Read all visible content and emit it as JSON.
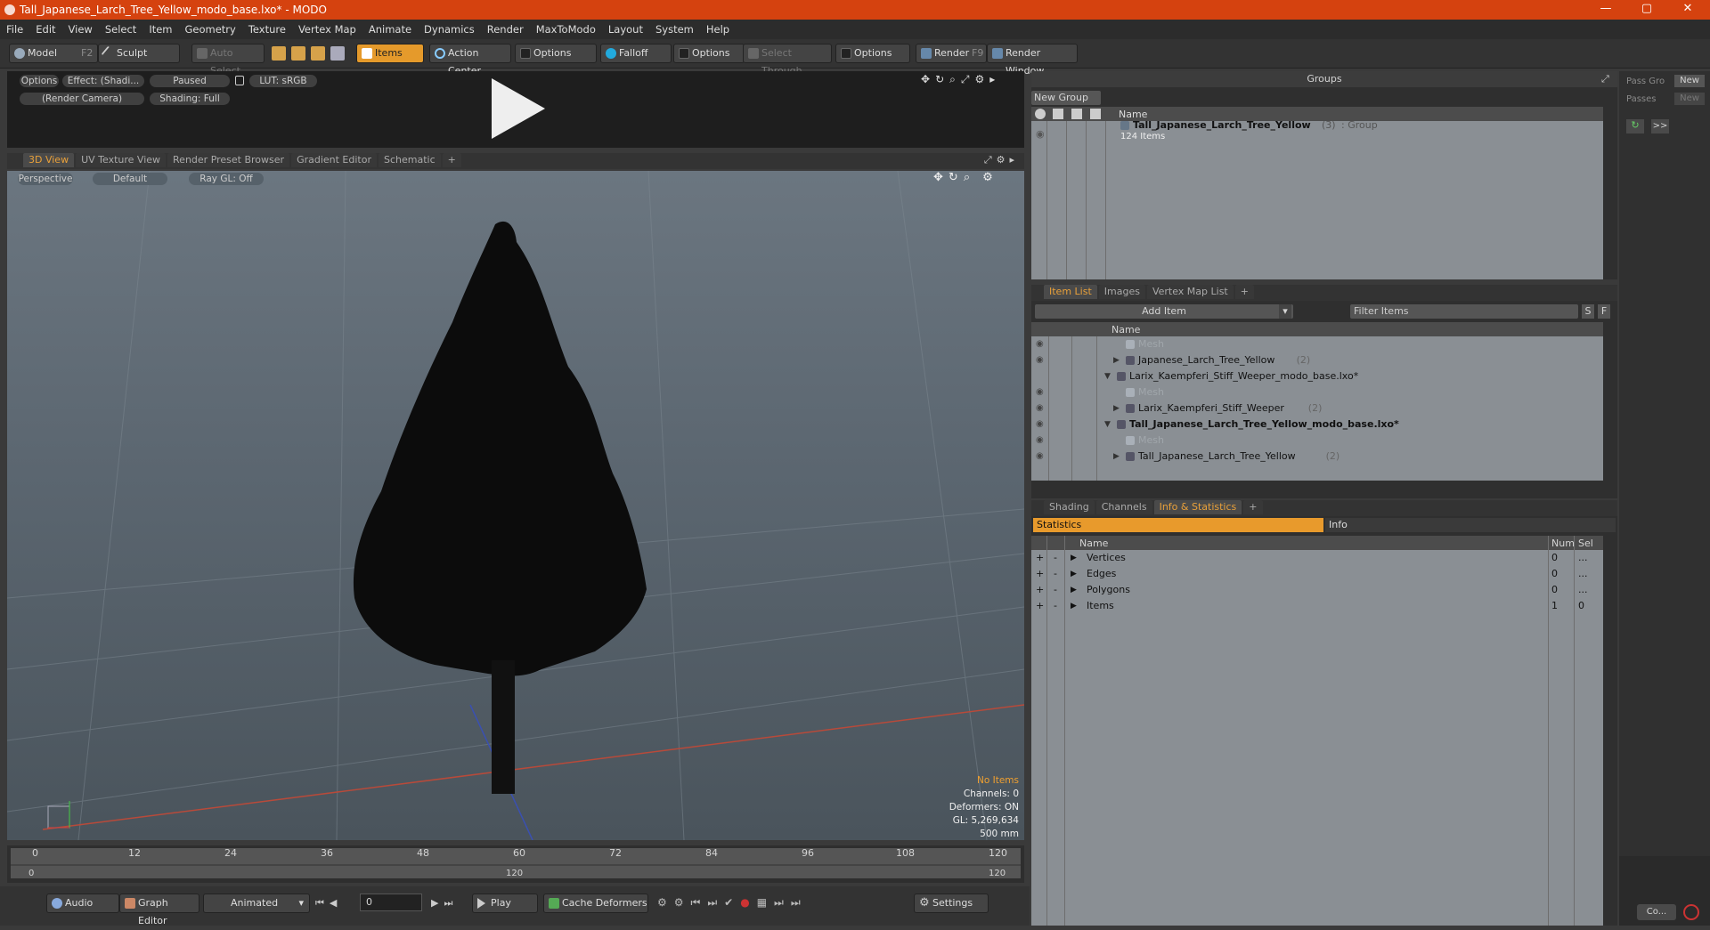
{
  "window": {
    "title": "Tall_Japanese_Larch_Tree_Yellow_modo_base.lxo* - MODO",
    "min": "—",
    "max": "▢",
    "close": "✕"
  },
  "menu": [
    "File",
    "Edit",
    "View",
    "Select",
    "Item",
    "Geometry",
    "Texture",
    "Vertex Map",
    "Animate",
    "Dynamics",
    "Render",
    "MaxToModo",
    "Layout",
    "System",
    "Help"
  ],
  "toolbar": {
    "model": "Model",
    "model_key": "F2",
    "sculpt": "Sculpt",
    "auto_select": "Auto Select",
    "items": "Items",
    "action_center": "Action Center",
    "options1": "Options",
    "falloff": "Falloff",
    "options2": "Options",
    "select_through": "Select Through",
    "options3": "Options",
    "render": "Render",
    "render_key": "F9",
    "render_window": "Render Window"
  },
  "render_preview": {
    "options": "Options",
    "effect": "Effect: (Shadi...",
    "paused": "Paused",
    "lut": "LUT: sRGB",
    "camera": "(Render Camera)",
    "shading": "Shading: Full"
  },
  "viewport_tabs": [
    "3D View",
    "UV Texture View",
    "Render Preset Browser",
    "Gradient Editor",
    "Schematic",
    "+"
  ],
  "viewport": {
    "perspective": "Perspective",
    "default": "Default",
    "raygl": "Ray GL: Off",
    "no_items": "No Items",
    "channels": "Channels: 0",
    "deformers": "Deformers: ON",
    "gl": "GL: 5,269,634",
    "scale": "500 mm"
  },
  "timeline": {
    "ticks": [
      "0",
      "12",
      "24",
      "36",
      "48",
      "60",
      "72",
      "84",
      "96",
      "108",
      "120"
    ],
    "start": "0",
    "mid": "120",
    "end": "120"
  },
  "bottombar": {
    "audio": "Audio",
    "graph_editor": "Graph Editor",
    "animated": "Animated",
    "frame": "0",
    "play": "Play",
    "cache": "Cache Deformers",
    "settings": "Settings"
  },
  "groups": {
    "title": "Groups",
    "new_group": "New Group",
    "col_name": "Name",
    "item_name": "Tall_Japanese_Larch_Tree_Yellow",
    "item_count": "(3)",
    "item_type": ": Group",
    "item_sub": "124 Items"
  },
  "passes": {
    "pass_groups": "Pass Gro",
    "passes": "Passes",
    "new1": "New",
    "new2": "New",
    "arrows": ">>"
  },
  "item_list": {
    "tabs": [
      "Item List",
      "Images",
      "Vertex Map List",
      "+"
    ],
    "add_item": "Add Item",
    "filter": "Filter Items",
    "s": "S",
    "f": "F",
    "col_name": "Name",
    "rows": [
      {
        "text": "Mesh",
        "indent": 2,
        "dim": true,
        "eye": true
      },
      {
        "text": "Japanese_Larch_Tree_Yellow",
        "count": "(2)",
        "indent": 2,
        "eye": true,
        "arrow": "▶"
      },
      {
        "text": "Larix_Kaempferi_Stiff_Weeper_modo_base.lxo*",
        "indent": 1,
        "arrow": "▼"
      },
      {
        "text": "Mesh",
        "indent": 2,
        "dim": true,
        "eye": true
      },
      {
        "text": "Larix_Kaempferi_Stiff_Weeper",
        "count": "(2)",
        "indent": 2,
        "eye": true,
        "arrow": "▶"
      },
      {
        "text": "Tall_Japanese_Larch_Tree_Yellow_modo_base.lxo*",
        "indent": 1,
        "arrow": "▼",
        "bold": true,
        "eye": true
      },
      {
        "text": "Mesh",
        "indent": 2,
        "dim": true,
        "eye": true
      },
      {
        "text": "Tall_Japanese_Larch_Tree_Yellow",
        "count": "(2)",
        "indent": 2,
        "eye": true,
        "arrow": "▶"
      }
    ]
  },
  "stats": {
    "tabs": [
      "Shading",
      "Channels",
      "Info & Statistics",
      "+"
    ],
    "statistics": "Statistics",
    "info": "Info",
    "col_name": "Name",
    "col_num": "Num",
    "col_sel": "Sel",
    "rows": [
      {
        "name": "Vertices",
        "num": "0",
        "sel": "..."
      },
      {
        "name": "Edges",
        "num": "0",
        "sel": "..."
      },
      {
        "name": "Polygons",
        "num": "0",
        "sel": "..."
      },
      {
        "name": "Items",
        "num": "1",
        "sel": "0"
      }
    ]
  },
  "far_right": {
    "co": "Co..."
  }
}
